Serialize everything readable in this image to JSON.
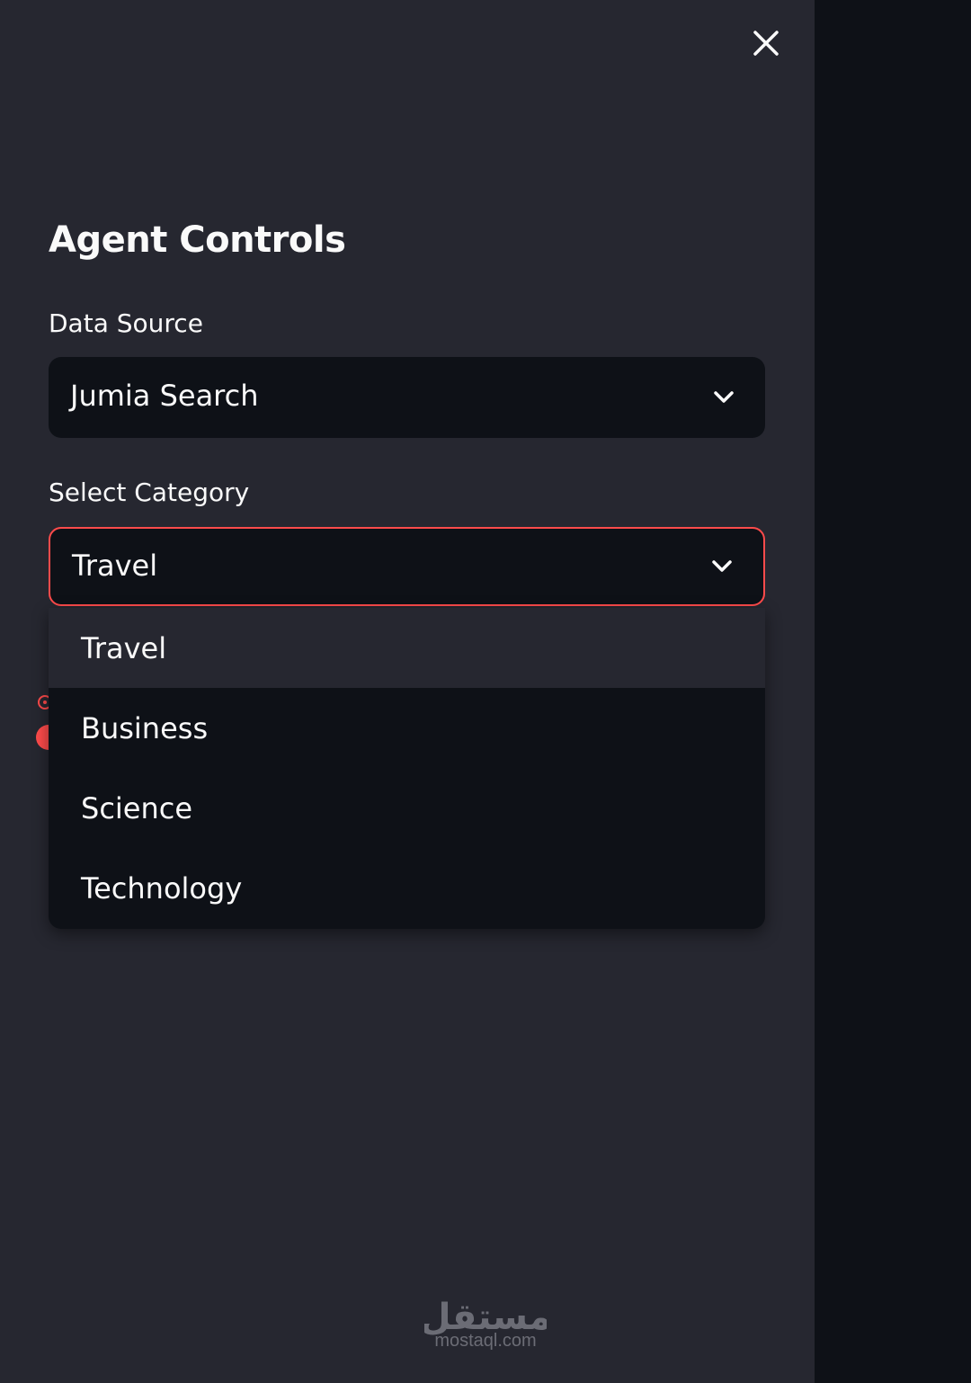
{
  "sidebar": {
    "title": "Agent Controls",
    "close_icon": "close-icon",
    "data_source": {
      "label": "Data Source",
      "value": "Jumia Search"
    },
    "category": {
      "label": "Select Category",
      "value": "Travel",
      "options": [
        "Travel",
        "Business",
        "Science",
        "Technology"
      ],
      "highlighted_option": "Travel"
    }
  },
  "watermark": {
    "text": "mostaql.com",
    "arabic": "مستقل"
  },
  "colors": {
    "sidebar_bg": "#262730",
    "main_bg": "#0e1117",
    "input_bg": "#0e1117",
    "focus_border": "#ff4b4b",
    "text": "#fafafa"
  }
}
